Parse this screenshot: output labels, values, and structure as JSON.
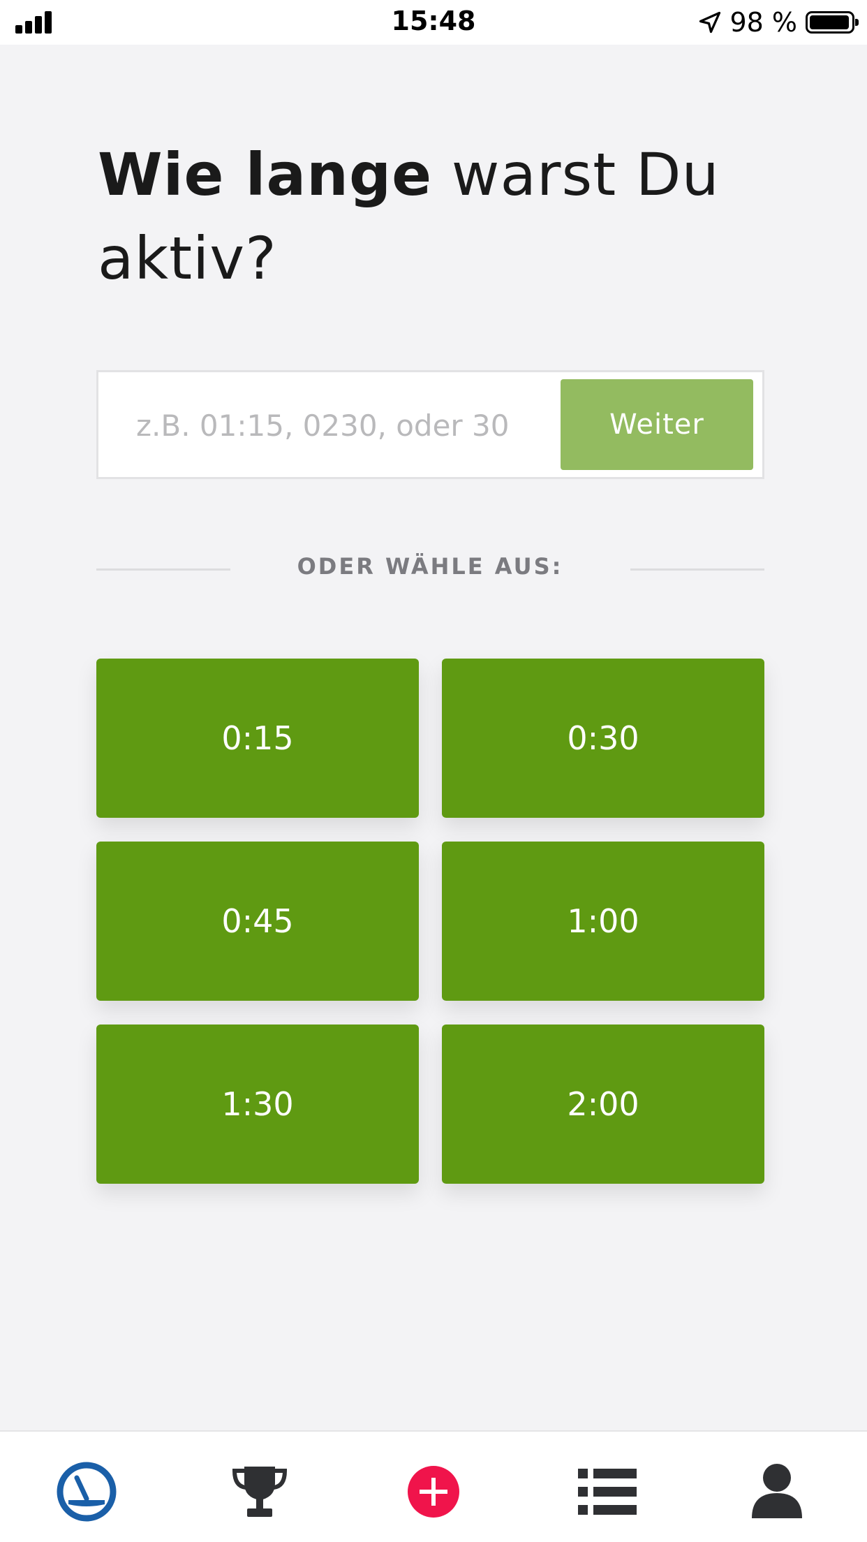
{
  "status_bar": {
    "time": "15:48",
    "battery_percent": "98 %"
  },
  "heading": {
    "bold": "Wie lange",
    "rest": " warst Du aktiv?"
  },
  "duration_input": {
    "placeholder": "z.B. 01:15, 0230, oder 30",
    "value": ""
  },
  "submit_button": {
    "label": "Weiter"
  },
  "divider": {
    "label": "ODER WÄHLE AUS:"
  },
  "presets": [
    {
      "label": "0:15"
    },
    {
      "label": "0:30"
    },
    {
      "label": "0:45"
    },
    {
      "label": "1:00"
    },
    {
      "label": "1:30"
    },
    {
      "label": "2:00"
    }
  ],
  "tab_bar": {
    "items": [
      {
        "icon": "dashboard-gauge-icon",
        "active": true
      },
      {
        "icon": "trophy-icon",
        "active": false
      },
      {
        "icon": "add-plus-icon",
        "active": false
      },
      {
        "icon": "list-icon",
        "active": false
      },
      {
        "icon": "profile-person-icon",
        "active": false
      }
    ]
  },
  "colors": {
    "preset_green": "#5f9a12",
    "submit_green": "#93bb60",
    "add_red": "#f0144b",
    "active_tab_blue": "#1a5fa8",
    "icon_dark": "#2f3033",
    "background": "#f3f3f5"
  }
}
